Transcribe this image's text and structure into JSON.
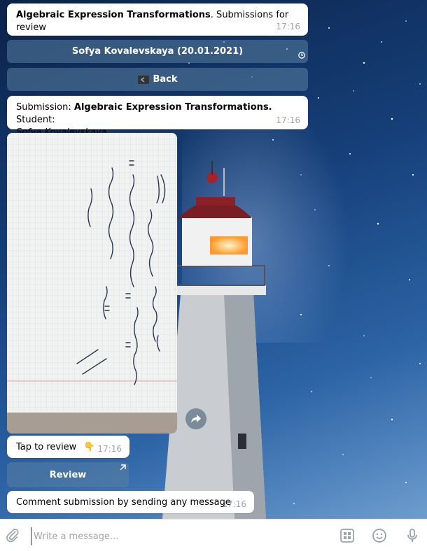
{
  "messages": {
    "header": {
      "title_bold": "Algebraic Expression Transformations",
      "title_rest": ". Submissions for review",
      "time": "17:16"
    },
    "student_button": {
      "label": "Sofya Kovalevskaya (20.01.2021)"
    },
    "back_button": {
      "label": "Back"
    },
    "submission": {
      "prefix": "Submission: ",
      "title_bold": "Algebraic Expression Transformations.",
      "student_label": " Student:",
      "student_name": "Sofya Kovalevskaya",
      "time": "17:16"
    },
    "tap_hint": {
      "text": "Tap to review",
      "emoji": "👇",
      "time": "17:16"
    },
    "review_button": {
      "label": "Review"
    },
    "comment_hint": {
      "text": "Comment submission by sending any message",
      "time": "17:16"
    }
  },
  "composer": {
    "placeholder": "Write a message..."
  },
  "icons": {
    "attach": "paperclip-icon",
    "keyboard": "bot-keyboard-icon",
    "emoji": "smile-icon",
    "voice": "microphone-icon",
    "share": "share-arrow-icon",
    "back": "back-icon",
    "clock": "clock-icon",
    "external": "external-arrow-icon"
  },
  "colors": {
    "bubble": "#ffffff",
    "time_text": "#9aa5ae",
    "inline_button": "#5a80a0",
    "composer_bg": "#ffffff"
  }
}
